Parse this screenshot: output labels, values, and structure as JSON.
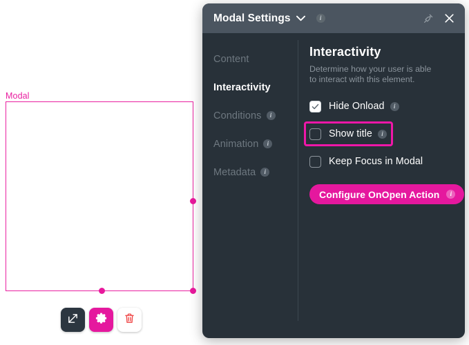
{
  "canvas": {
    "element_label": "Modal",
    "accent_color": "#e91ea0",
    "handles": [
      "right-mid",
      "bottom-mid",
      "bottom-right"
    ],
    "toolbar": [
      {
        "name": "open-external-button",
        "icon": "external-link-icon",
        "style": "dark"
      },
      {
        "name": "settings-gear-button",
        "icon": "gear-icon",
        "style": "magenta"
      },
      {
        "name": "delete-button",
        "icon": "trash-icon",
        "style": "white"
      }
    ]
  },
  "panel": {
    "header": {
      "title": "Modal Settings",
      "dropdown_icon": "chevron-down-icon",
      "info_icon": "info-icon",
      "pin_icon": "pin-icon",
      "close_icon": "close-icon"
    },
    "sidebar": {
      "items": [
        {
          "label": "Content",
          "active": false,
          "has_info": false
        },
        {
          "label": "Interactivity",
          "active": true,
          "has_info": false
        },
        {
          "label": "Conditions",
          "active": false,
          "has_info": true
        },
        {
          "label": "Animation",
          "active": false,
          "has_info": true
        },
        {
          "label": "Metadata",
          "active": false,
          "has_info": true
        }
      ]
    },
    "content": {
      "heading": "Interactivity",
      "description": "Determine how your user is able to interact with this element.",
      "checkboxes": [
        {
          "label": "Hide Onload",
          "checked": true,
          "has_info": true,
          "highlighted": false
        },
        {
          "label": "Show title",
          "checked": false,
          "has_info": true,
          "highlighted": true
        },
        {
          "label": "Keep Focus in Modal",
          "checked": false,
          "has_info": false,
          "highlighted": false
        }
      ],
      "action_button": {
        "label": "Configure OnOpen Action",
        "has_info": true,
        "color": "#e5189e"
      }
    }
  },
  "colors": {
    "accent_magenta": "#e5189e",
    "highlight_magenta": "#ef17a8",
    "panel_background": "#283139",
    "panel_header": "#4b5560",
    "canvas_background": "#ffffff"
  }
}
